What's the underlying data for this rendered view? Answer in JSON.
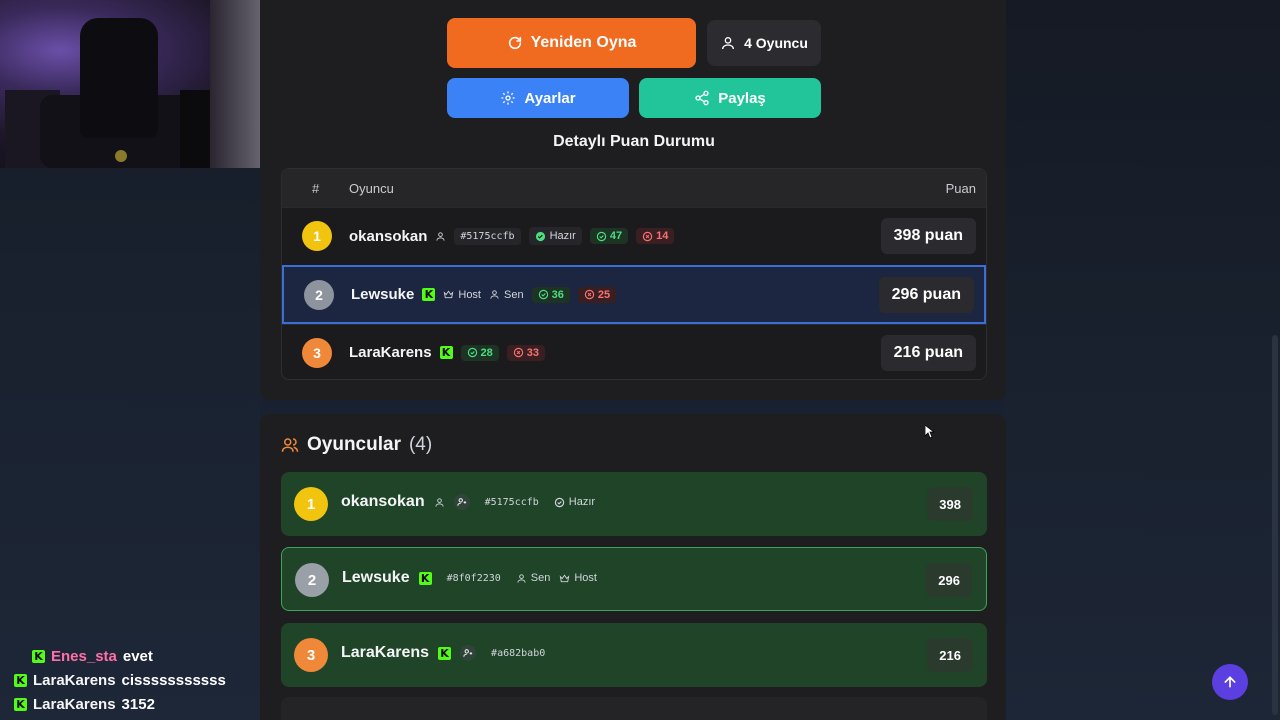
{
  "buttons": {
    "replay": "Yeniden Oyna",
    "players": "4 Oyuncu",
    "settings": "Ayarlar",
    "share": "Paylaş"
  },
  "score_section": {
    "title": "Detaylı Puan Durumu",
    "columns": {
      "rank": "#",
      "player": "Oyuncu",
      "score": "Puan"
    },
    "rows": [
      {
        "rank": "1",
        "name": "okansokan",
        "id": "#5175ccfb",
        "ready": "Hazır",
        "correct": "47",
        "wrong": "14",
        "score": "398 puan"
      },
      {
        "rank": "2",
        "name": "Lewsuke",
        "host": "Host",
        "you": "Sen",
        "correct": "36",
        "wrong": "25",
        "score": "296 puan"
      },
      {
        "rank": "3",
        "name": "LaraKarens",
        "correct": "28",
        "wrong": "33",
        "score": "216 puan"
      }
    ]
  },
  "players_section": {
    "title": "Oyuncular",
    "count": "(4)",
    "players": [
      {
        "rank": "1",
        "name": "okansokan",
        "id": "#5175ccfb",
        "ready": "Hazır",
        "score": "398"
      },
      {
        "rank": "2",
        "name": "Lewsuke",
        "id": "#8f0f2230",
        "you": "Sen",
        "host": "Host",
        "score": "296"
      },
      {
        "rank": "3",
        "name": "LaraKarens",
        "id": "#a682bab0",
        "score": "216"
      }
    ]
  },
  "chat": [
    {
      "user": "Enes_sta",
      "message": "evet",
      "color": "#ff6fa8"
    },
    {
      "user": "LaraKarens",
      "message": "cisssssssssss",
      "color": "#f5f5f5"
    },
    {
      "user": "LaraKarens",
      "message": "3152",
      "color": "#f5f5f5"
    }
  ],
  "colors": {
    "accent_orange": "#f06a1f",
    "accent_blue": "#3b82f6",
    "accent_teal": "#22c59a",
    "kick_green": "#53fc18",
    "fab_purple": "#5b3fe0"
  }
}
